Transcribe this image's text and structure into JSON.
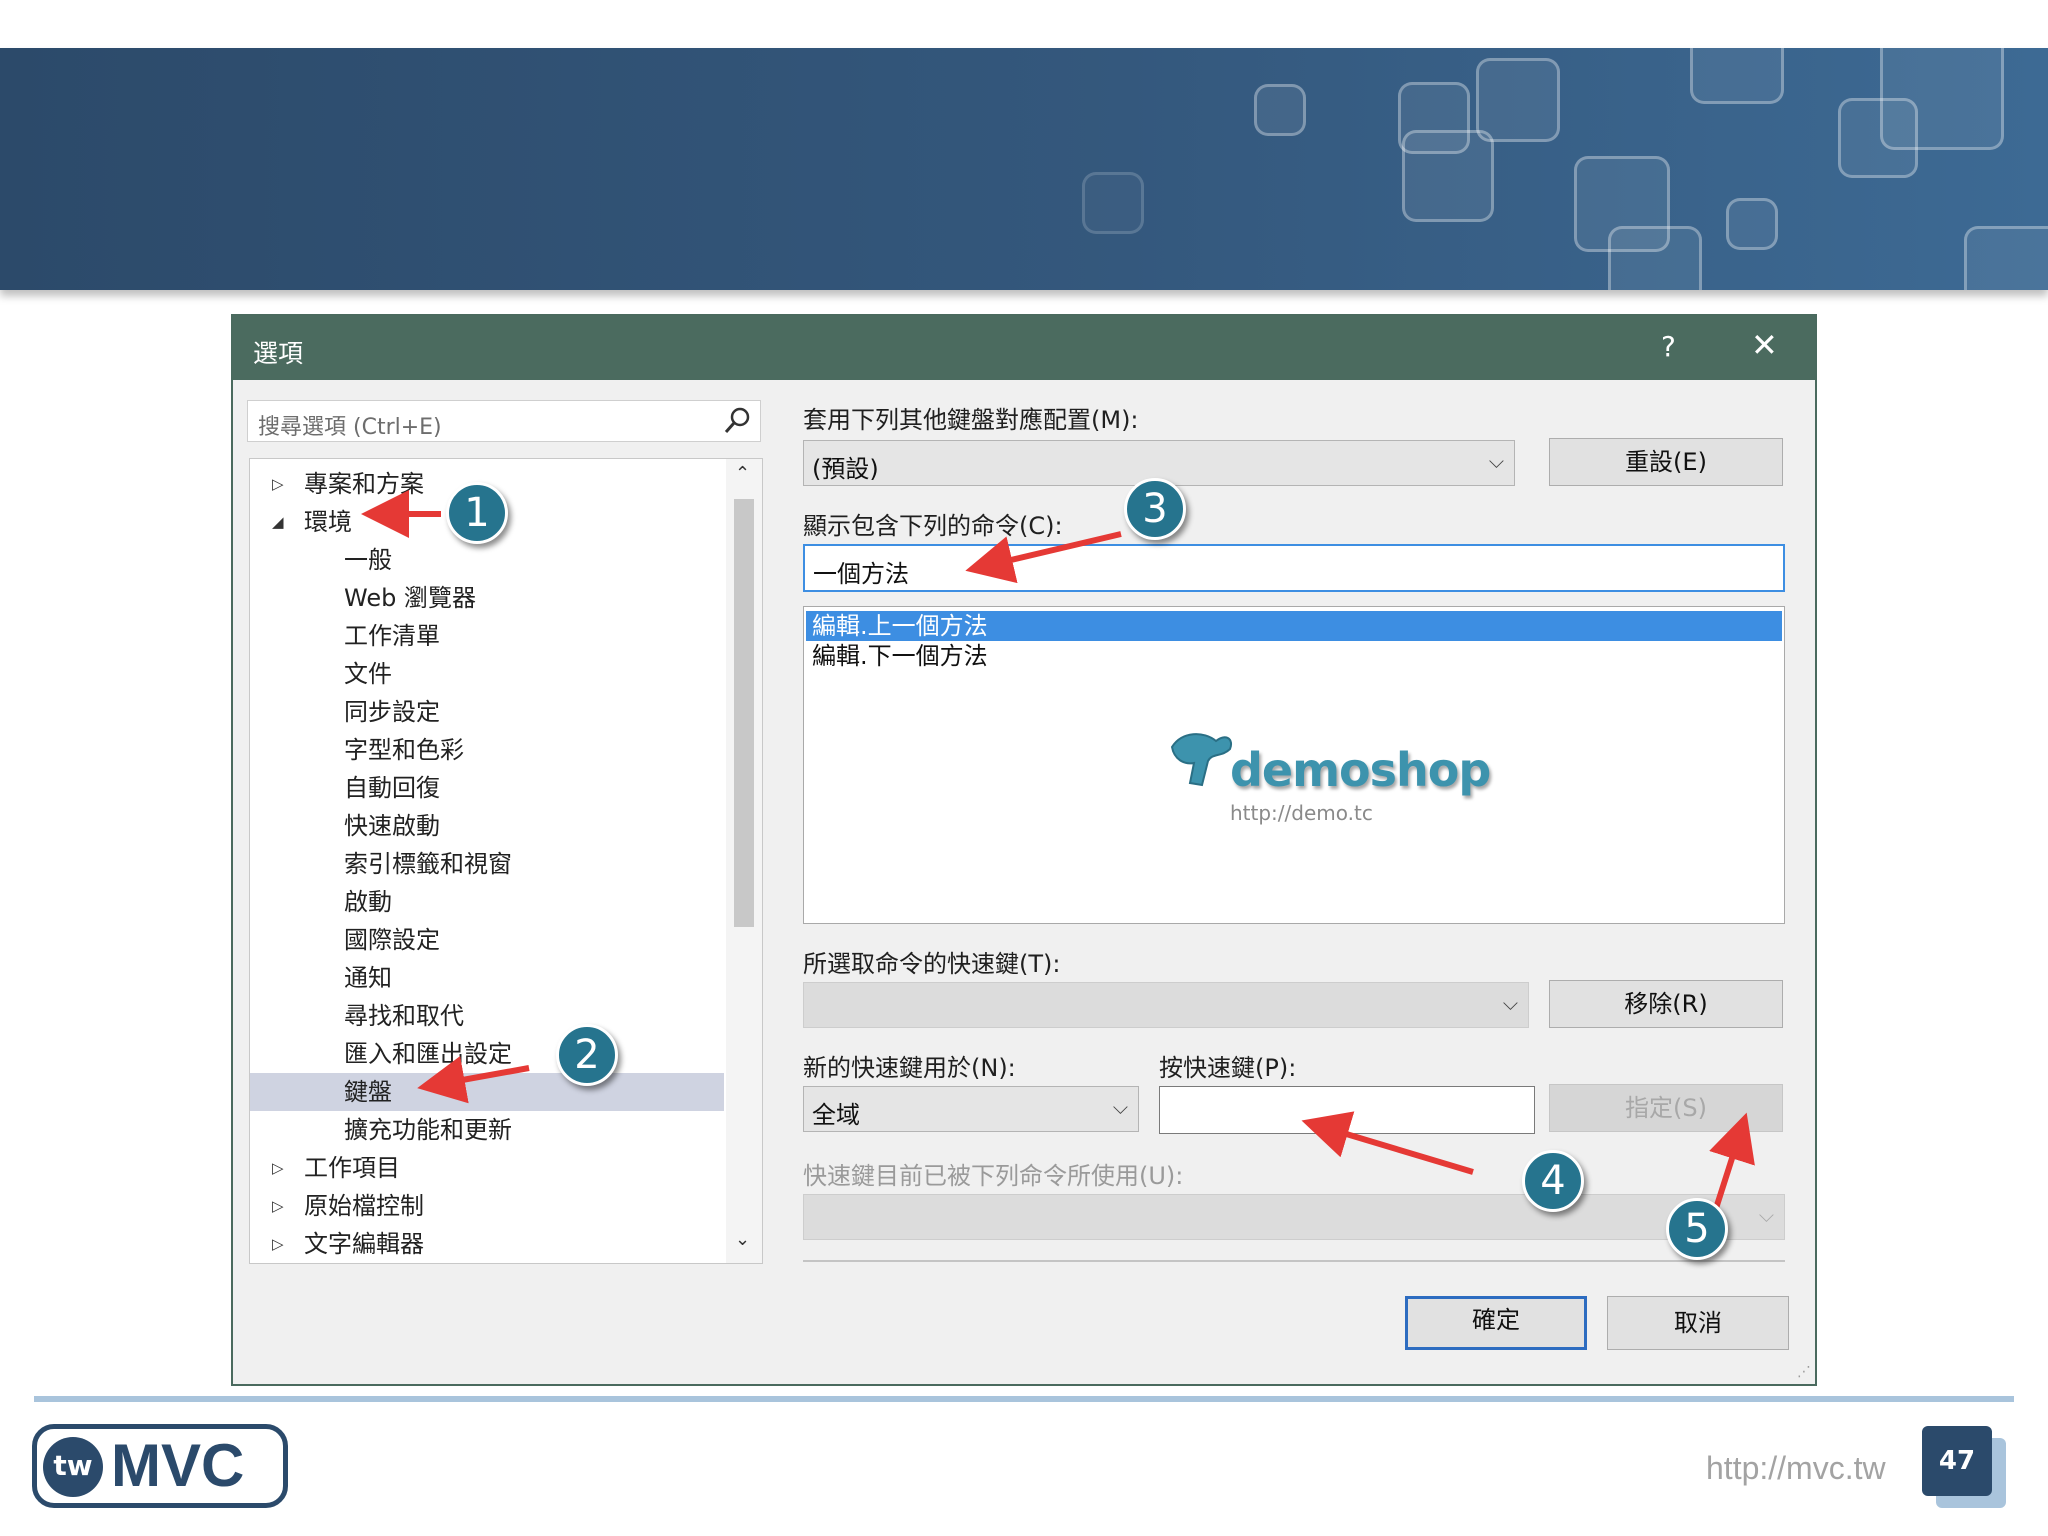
{
  "dialog": {
    "title": "選項",
    "help": "?",
    "close": "✕"
  },
  "search": {
    "placeholder": "搜尋選項 (Ctrl+E)"
  },
  "tree": {
    "items": [
      {
        "label": "專案和方案",
        "expander": "▷"
      },
      {
        "label": "環境",
        "expander": "◢"
      },
      {
        "label": "一般"
      },
      {
        "label": "Web 瀏覽器"
      },
      {
        "label": "工作清單"
      },
      {
        "label": "文件"
      },
      {
        "label": "同步設定"
      },
      {
        "label": "字型和色彩"
      },
      {
        "label": "自動回復"
      },
      {
        "label": "快速啟動"
      },
      {
        "label": "索引標籤和視窗"
      },
      {
        "label": "啟動"
      },
      {
        "label": "國際設定"
      },
      {
        "label": "通知"
      },
      {
        "label": "尋找和取代"
      },
      {
        "label": "匯入和匯出設定"
      },
      {
        "label": "鍵盤",
        "selected": true
      },
      {
        "label": "擴充功能和更新"
      },
      {
        "label": "工作項目",
        "expander": "▷"
      },
      {
        "label": "原始檔控制",
        "expander": "▷"
      },
      {
        "label": "文字編輯器",
        "expander": "▷"
      }
    ],
    "scroll_up": "⌃",
    "scroll_down": "⌄"
  },
  "keyboard": {
    "mapping_label": "套用下列其他鍵盤對應配置(M):",
    "mapping_value": "(預設)",
    "reset_button": "重設(E)",
    "show_commands_label": "顯示包含下列的命令(C):",
    "filter_value": "一個方法",
    "commands": [
      {
        "label": "編輯.上一個方法",
        "selected": true
      },
      {
        "label": "編輯.下一個方法"
      }
    ],
    "shortcut_label": "所選取命令的快速鍵(T):",
    "shortcut_value": "",
    "remove_button": "移除(R)",
    "use_in_label": "新的快速鍵用於(N):",
    "use_in_value": "全域",
    "press_keys_label": "按快速鍵(P):",
    "press_keys_value": "",
    "assign_button": "指定(S)",
    "used_by_label": "快速鍵目前已被下列命令所使用(U):",
    "used_by_value": "",
    "ok_button": "確定",
    "cancel_button": "取消"
  },
  "watermark": {
    "name": "demoshop",
    "url": "http://demo.tc"
  },
  "callouts": [
    "1",
    "2",
    "3",
    "4",
    "5"
  ],
  "annotation_color": "#e53935",
  "footer": {
    "logo_tw": "tw",
    "logo_mvc": "MVC",
    "url": "http://mvc.tw",
    "page_number": "47"
  },
  "colors": {
    "banner": "#2c4a6a",
    "titlebar": "#4b6b5f",
    "selection": "#3d8ee2",
    "callout": "#26748e"
  }
}
